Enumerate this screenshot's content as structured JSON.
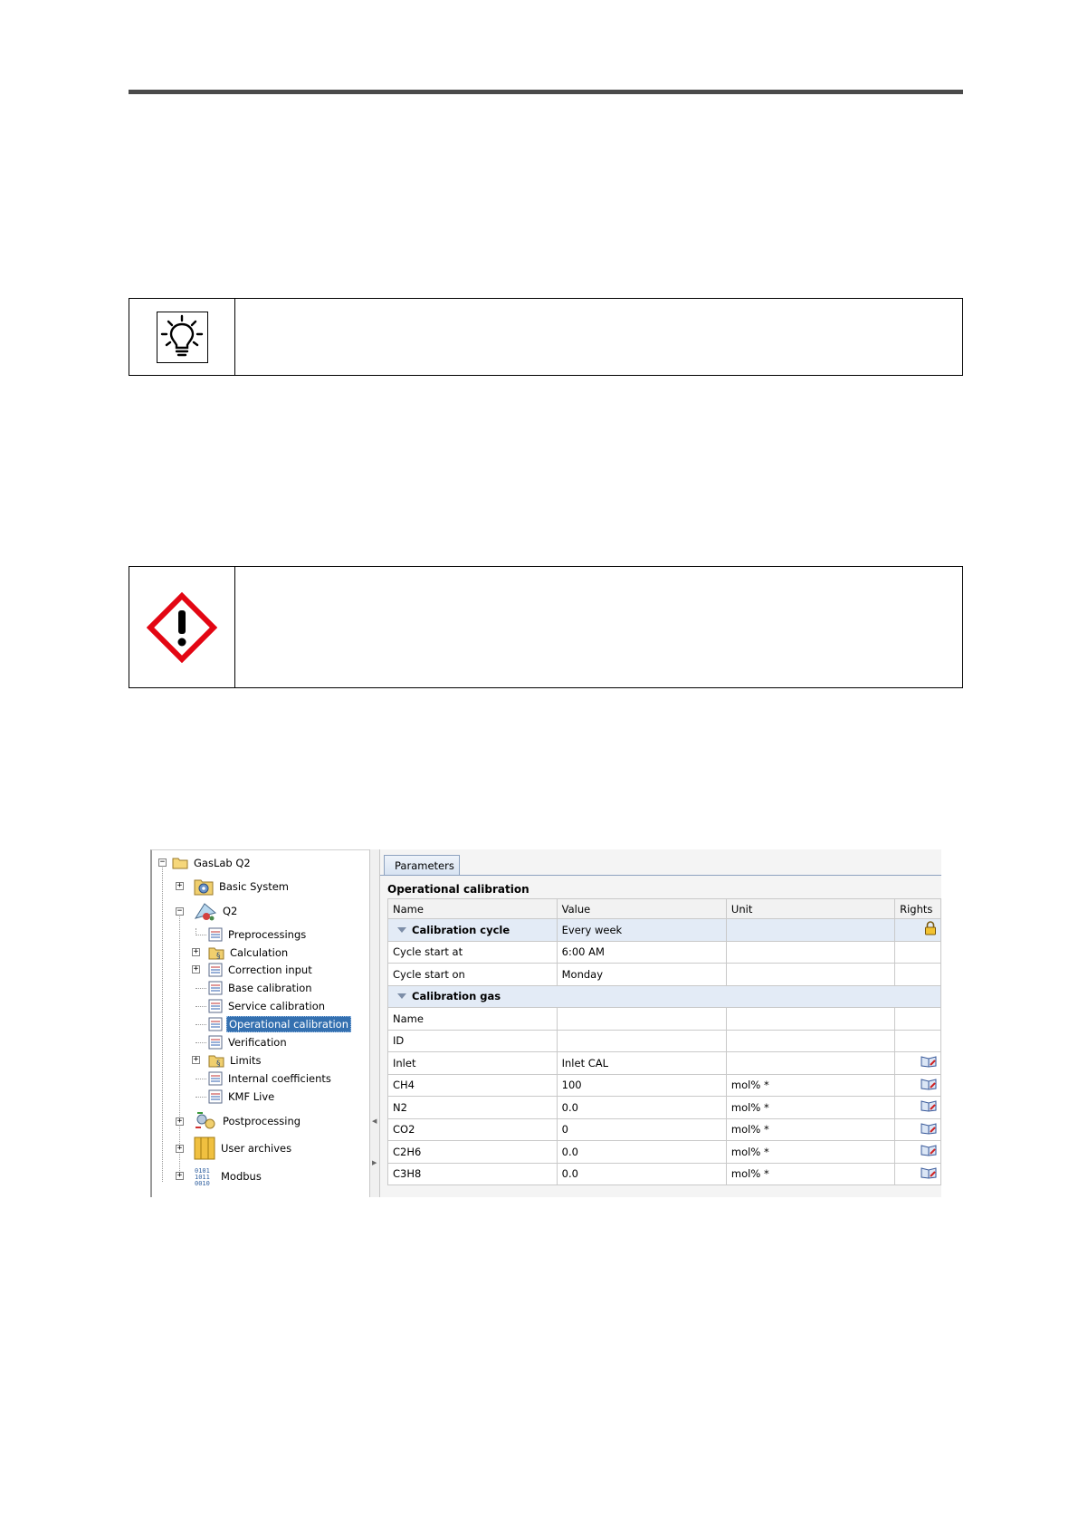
{
  "colors": {
    "rule": "#4a4a4a",
    "warning_red": "#e30613",
    "selection": "#3470b0"
  },
  "tip_notice": {
    "icon": "lightbulb-icon",
    "text": ""
  },
  "warning_notice": {
    "icon": "ghs-exclamation-icon",
    "text": ""
  },
  "tree": {
    "root": "GasLab Q2",
    "items": [
      {
        "label": "Basic System",
        "icon": "gear-folder-icon"
      },
      {
        "label": "Q2",
        "icon": "q2-device-icon"
      },
      {
        "label": "Preprocessings",
        "icon": "parameter-list-icon"
      },
      {
        "label": "Calculation",
        "icon": "folder-icon"
      },
      {
        "label": "Correction input",
        "icon": "parameter-list-icon"
      },
      {
        "label": "Base calibration",
        "icon": "parameter-list-icon"
      },
      {
        "label": "Service calibration",
        "icon": "parameter-list-icon"
      },
      {
        "label": "Operational calibration",
        "icon": "parameter-list-icon"
      },
      {
        "label": "Verification",
        "icon": "parameter-list-icon"
      },
      {
        "label": "Limits",
        "icon": "folder-icon"
      },
      {
        "label": "Internal coefficients",
        "icon": "parameter-list-icon"
      },
      {
        "label": "KMF Live",
        "icon": "parameter-list-icon"
      },
      {
        "label": "Postprocessing",
        "icon": "gears-icon"
      },
      {
        "label": "User archives",
        "icon": "archive-icon"
      },
      {
        "label": "Modbus",
        "icon": "binary-icon"
      }
    ]
  },
  "panel": {
    "tab": "Parameters",
    "section_title": "Operational calibration",
    "columns": [
      "Name",
      "Value",
      "Unit",
      "Rights"
    ],
    "rows": [
      {
        "group": true,
        "name": "Calibration cycle",
        "value": "Every week",
        "unit": "",
        "rights": "lock-icon"
      },
      {
        "name": "Cycle start at",
        "value": "6:00 AM",
        "unit": "",
        "rights": ""
      },
      {
        "name": "Cycle start on",
        "value": "Monday",
        "unit": "",
        "rights": ""
      },
      {
        "group": true,
        "name": "Calibration gas",
        "value": "",
        "unit": "",
        "rights": ""
      },
      {
        "name": "Name",
        "value": "",
        "unit": "",
        "rights": ""
      },
      {
        "name": "ID",
        "value": "",
        "unit": "",
        "rights": ""
      },
      {
        "name": "Inlet",
        "value": "Inlet CAL",
        "unit": "",
        "rights": "book-edit-icon"
      },
      {
        "name": "CH4",
        "value": "100",
        "unit": "mol% *",
        "rights": "book-edit-icon"
      },
      {
        "name": "N2",
        "value": "0.0",
        "unit": "mol% *",
        "rights": "book-edit-icon"
      },
      {
        "name": "CO2",
        "value": "0",
        "unit": "mol% *",
        "rights": "book-edit-icon"
      },
      {
        "name": "C2H6",
        "value": "0.0",
        "unit": "mol% *",
        "rights": "book-edit-icon"
      },
      {
        "name": "C3H8",
        "value": "0.0",
        "unit": "mol% *",
        "rights": "book-edit-icon"
      }
    ]
  }
}
